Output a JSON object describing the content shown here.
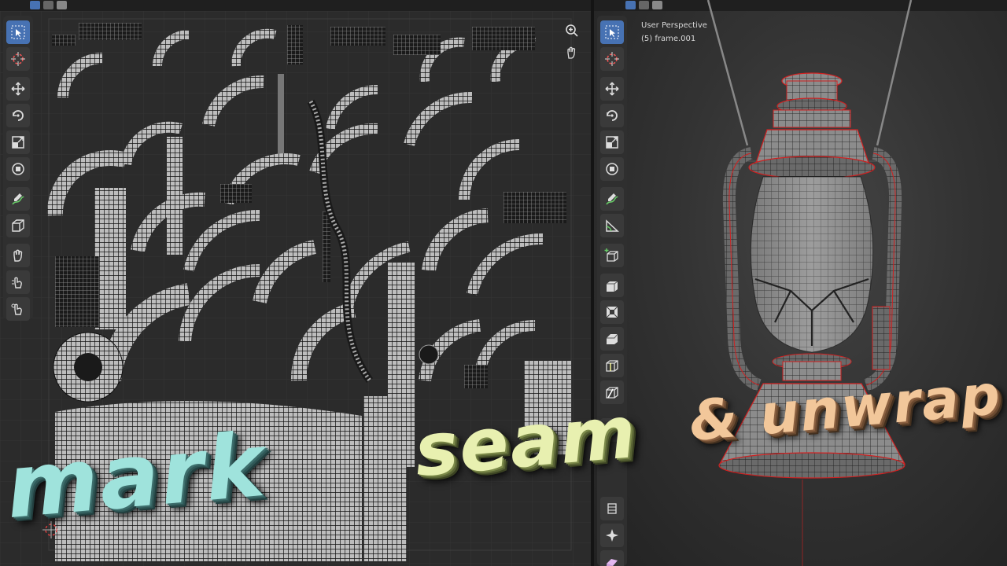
{
  "viewport": {
    "mode_line": "User Perspective",
    "object_line": "(5) frame.001"
  },
  "uv_toolbar": {
    "tools": [
      "select-box-icon",
      "cursor-icon",
      "move-icon",
      "rotate-icon",
      "scale-icon",
      "transform-icon",
      "annotate-icon",
      "cube-icon",
      "grab-icon",
      "pinch-icon",
      "relax-icon"
    ]
  },
  "viewport_toolbar": {
    "tools": [
      "select-box-icon",
      "cursor-icon",
      "move-icon",
      "rotate-icon",
      "scale-icon",
      "transform-icon",
      "annotate-icon",
      "measure-icon",
      "add-cube-icon",
      "extrude-icon",
      "inset-icon",
      "bevel-icon",
      "loop-cut-icon",
      "knife-icon",
      "poly-build-icon",
      "spin-icon",
      "smooth-icon",
      "edge-slide-icon",
      "shrink-fatten-icon",
      "shear-icon"
    ]
  },
  "title": {
    "word1": "mark",
    "word2": "seam",
    "word3": "& unwrap"
  },
  "colors": {
    "active_tool": "#4772b3",
    "blender_orange": "#f57c22",
    "blender_blue": "#2a5b8c",
    "seam_red": "#d02020"
  }
}
